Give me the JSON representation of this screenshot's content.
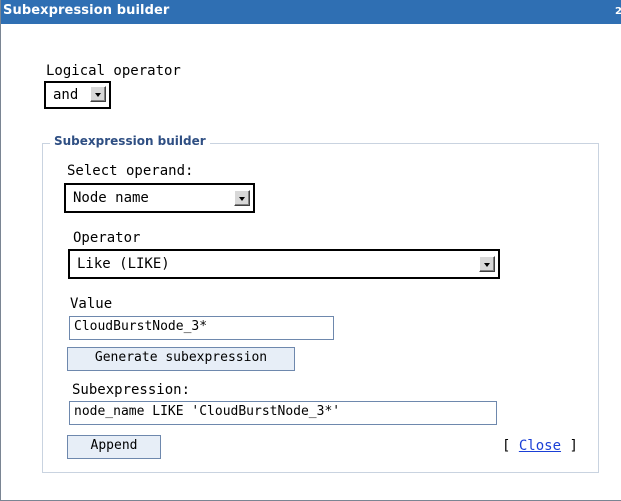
{
  "window": {
    "title": "Subexpression builder",
    "title_edge": "2"
  },
  "logical_operator": {
    "label": "Logical operator",
    "selected": "and"
  },
  "builder": {
    "legend": "Subexpression builder",
    "operand": {
      "label": "Select operand:",
      "selected": "Node name"
    },
    "operator": {
      "label": "Operator",
      "selected": "Like (LIKE)"
    },
    "value": {
      "label": "Value",
      "text": "CloudBurstNode_3*"
    },
    "generate_label": "Generate subexpression",
    "subexpression": {
      "label": "Subexpression:",
      "text": "node_name LIKE 'CloudBurstNode_3*'"
    },
    "append_label": "Append",
    "close": {
      "open_bracket": "[ ",
      "label": "Close",
      "close_bracket": " ]"
    }
  },
  "colors": {
    "titlebar": "#2f6fb3",
    "legend_text": "#2f4f83",
    "button_bg": "#e7eef7",
    "link": "#1a3fd6"
  }
}
